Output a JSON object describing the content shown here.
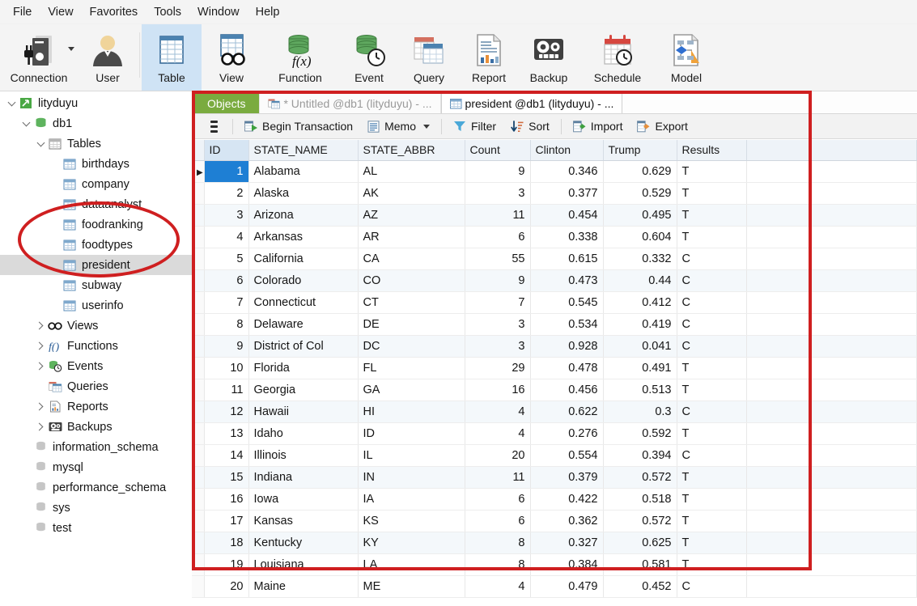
{
  "menubar": {
    "items": [
      "File",
      "View",
      "Favorites",
      "Tools",
      "Window",
      "Help"
    ]
  },
  "ribbon": {
    "buttons": [
      {
        "label": "Connection",
        "icon": "connection-icon",
        "has_dropdown": true,
        "selected": false
      },
      {
        "label": "User",
        "icon": "user-icon",
        "has_dropdown": false,
        "selected": false
      },
      {
        "label": "Table",
        "icon": "table-icon",
        "has_dropdown": false,
        "selected": true
      },
      {
        "label": "View",
        "icon": "view-icon",
        "has_dropdown": false,
        "selected": false
      },
      {
        "label": "Function",
        "icon": "function-icon",
        "has_dropdown": false,
        "selected": false
      },
      {
        "label": "Event",
        "icon": "event-icon",
        "has_dropdown": false,
        "selected": false
      },
      {
        "label": "Query",
        "icon": "query-icon",
        "has_dropdown": false,
        "selected": false
      },
      {
        "label": "Report",
        "icon": "report-icon",
        "has_dropdown": false,
        "selected": false
      },
      {
        "label": "Backup",
        "icon": "backup-icon",
        "has_dropdown": false,
        "selected": false
      },
      {
        "label": "Schedule",
        "icon": "schedule-icon",
        "has_dropdown": false,
        "selected": false
      },
      {
        "label": "Model",
        "icon": "model-icon",
        "has_dropdown": false,
        "selected": false
      }
    ]
  },
  "sidebar": {
    "nodes": [
      {
        "label": "lityduyu",
        "indent": 0,
        "twisty": "open",
        "icon": "connection-node-icon",
        "highlight": false
      },
      {
        "label": "db1",
        "indent": 1,
        "twisty": "open",
        "icon": "database-green-icon",
        "highlight": false
      },
      {
        "label": "Tables",
        "indent": 2,
        "twisty": "open",
        "icon": "tables-folder-icon",
        "highlight": false
      },
      {
        "label": "birthdays",
        "indent": 3,
        "twisty": "none",
        "icon": "table-icon",
        "highlight": false
      },
      {
        "label": "company",
        "indent": 3,
        "twisty": "none",
        "icon": "table-icon",
        "highlight": false
      },
      {
        "label": "dataanalyst",
        "indent": 3,
        "twisty": "none",
        "icon": "table-icon",
        "highlight": false
      },
      {
        "label": "foodranking",
        "indent": 3,
        "twisty": "none",
        "icon": "table-icon",
        "highlight": false
      },
      {
        "label": "foodtypes",
        "indent": 3,
        "twisty": "none",
        "icon": "table-icon",
        "highlight": false
      },
      {
        "label": "president",
        "indent": 3,
        "twisty": "none",
        "icon": "table-icon",
        "highlight": true
      },
      {
        "label": "subway",
        "indent": 3,
        "twisty": "none",
        "icon": "table-icon",
        "highlight": false
      },
      {
        "label": "userinfo",
        "indent": 3,
        "twisty": "none",
        "icon": "table-icon",
        "highlight": false
      },
      {
        "label": "Views",
        "indent": 2,
        "twisty": "closed",
        "icon": "views-icon",
        "highlight": false
      },
      {
        "label": "Functions",
        "indent": 2,
        "twisty": "closed",
        "icon": "functions-icon",
        "highlight": false
      },
      {
        "label": "Events",
        "indent": 2,
        "twisty": "closed",
        "icon": "events-icon",
        "highlight": false
      },
      {
        "label": "Queries",
        "indent": 2,
        "twisty": "none",
        "icon": "queries-icon",
        "highlight": false
      },
      {
        "label": "Reports",
        "indent": 2,
        "twisty": "closed",
        "icon": "reports-icon",
        "highlight": false
      },
      {
        "label": "Backups",
        "indent": 2,
        "twisty": "closed",
        "icon": "backups-icon",
        "highlight": false
      },
      {
        "label": "information_schema",
        "indent": 1,
        "twisty": "none",
        "icon": "database-grey-icon",
        "highlight": false
      },
      {
        "label": "mysql",
        "indent": 1,
        "twisty": "none",
        "icon": "database-grey-icon",
        "highlight": false
      },
      {
        "label": "performance_schema",
        "indent": 1,
        "twisty": "none",
        "icon": "database-grey-icon",
        "highlight": false
      },
      {
        "label": "sys",
        "indent": 1,
        "twisty": "none",
        "icon": "database-grey-icon",
        "highlight": false
      },
      {
        "label": "test",
        "indent": 1,
        "twisty": "none",
        "icon": "database-grey-icon",
        "highlight": false
      }
    ]
  },
  "tabs": [
    {
      "label": "Objects",
      "type": "objects",
      "icon": null
    },
    {
      "label": "* Untitled @db1 (lityduyu) - ...",
      "type": "inactive",
      "icon": "query-tab-icon"
    },
    {
      "label": "president @db1 (lityduyu) - ...",
      "type": "active",
      "icon": "table-tab-icon"
    }
  ],
  "grid_toolbar": {
    "menu_icon": "hamburger-icon",
    "items": [
      {
        "label": "Begin Transaction",
        "icon": "transaction-icon",
        "dropdown": false
      },
      {
        "label": "Memo",
        "icon": "memo-icon",
        "dropdown": true
      },
      {
        "label": "Filter",
        "icon": "filter-icon",
        "dropdown": false
      },
      {
        "label": "Sort",
        "icon": "sort-icon",
        "dropdown": false
      },
      {
        "label": "Import",
        "icon": "import-icon",
        "dropdown": false
      },
      {
        "label": "Export",
        "icon": "export-icon",
        "dropdown": false
      }
    ]
  },
  "table": {
    "columns": [
      "ID",
      "STATE_NAME",
      "STATE_ABBR",
      "Count",
      "Clinton",
      "Trump",
      "Results"
    ],
    "selected_row_index": 0,
    "rows": [
      {
        "ID": "1",
        "STATE_NAME": "Alabama",
        "STATE_ABBR": "AL",
        "Count": "9",
        "Clinton": "0.346",
        "Trump": "0.629",
        "Results": "T"
      },
      {
        "ID": "2",
        "STATE_NAME": "Alaska",
        "STATE_ABBR": "AK",
        "Count": "3",
        "Clinton": "0.377",
        "Trump": "0.529",
        "Results": "T"
      },
      {
        "ID": "3",
        "STATE_NAME": "Arizona",
        "STATE_ABBR": "AZ",
        "Count": "11",
        "Clinton": "0.454",
        "Trump": "0.495",
        "Results": "T"
      },
      {
        "ID": "4",
        "STATE_NAME": "Arkansas",
        "STATE_ABBR": "AR",
        "Count": "6",
        "Clinton": "0.338",
        "Trump": "0.604",
        "Results": "T"
      },
      {
        "ID": "5",
        "STATE_NAME": "California",
        "STATE_ABBR": "CA",
        "Count": "55",
        "Clinton": "0.615",
        "Trump": "0.332",
        "Results": "C"
      },
      {
        "ID": "6",
        "STATE_NAME": "Colorado",
        "STATE_ABBR": "CO",
        "Count": "9",
        "Clinton": "0.473",
        "Trump": "0.44",
        "Results": "C"
      },
      {
        "ID": "7",
        "STATE_NAME": "Connecticut",
        "STATE_ABBR": "CT",
        "Count": "7",
        "Clinton": "0.545",
        "Trump": "0.412",
        "Results": "C"
      },
      {
        "ID": "8",
        "STATE_NAME": "Delaware",
        "STATE_ABBR": "DE",
        "Count": "3",
        "Clinton": "0.534",
        "Trump": "0.419",
        "Results": "C"
      },
      {
        "ID": "9",
        "STATE_NAME": "District of Col",
        "STATE_ABBR": "DC",
        "Count": "3",
        "Clinton": "0.928",
        "Trump": "0.041",
        "Results": "C"
      },
      {
        "ID": "10",
        "STATE_NAME": "Florida",
        "STATE_ABBR": "FL",
        "Count": "29",
        "Clinton": "0.478",
        "Trump": "0.491",
        "Results": "T"
      },
      {
        "ID": "11",
        "STATE_NAME": "Georgia",
        "STATE_ABBR": "GA",
        "Count": "16",
        "Clinton": "0.456",
        "Trump": "0.513",
        "Results": "T"
      },
      {
        "ID": "12",
        "STATE_NAME": "Hawaii",
        "STATE_ABBR": "HI",
        "Count": "4",
        "Clinton": "0.622",
        "Trump": "0.3",
        "Results": "C"
      },
      {
        "ID": "13",
        "STATE_NAME": "Idaho",
        "STATE_ABBR": "ID",
        "Count": "4",
        "Clinton": "0.276",
        "Trump": "0.592",
        "Results": "T"
      },
      {
        "ID": "14",
        "STATE_NAME": "Illinois",
        "STATE_ABBR": "IL",
        "Count": "20",
        "Clinton": "0.554",
        "Trump": "0.394",
        "Results": "C"
      },
      {
        "ID": "15",
        "STATE_NAME": "Indiana",
        "STATE_ABBR": "IN",
        "Count": "11",
        "Clinton": "0.379",
        "Trump": "0.572",
        "Results": "T"
      },
      {
        "ID": "16",
        "STATE_NAME": "Iowa",
        "STATE_ABBR": "IA",
        "Count": "6",
        "Clinton": "0.422",
        "Trump": "0.518",
        "Results": "T"
      },
      {
        "ID": "17",
        "STATE_NAME": "Kansas",
        "STATE_ABBR": "KS",
        "Count": "6",
        "Clinton": "0.362",
        "Trump": "0.572",
        "Results": "T"
      },
      {
        "ID": "18",
        "STATE_NAME": "Kentucky",
        "STATE_ABBR": "KY",
        "Count": "8",
        "Clinton": "0.327",
        "Trump": "0.625",
        "Results": "T"
      },
      {
        "ID": "19",
        "STATE_NAME": "Louisiana",
        "STATE_ABBR": "LA",
        "Count": "8",
        "Clinton": "0.384",
        "Trump": "0.581",
        "Results": "T"
      },
      {
        "ID": "20",
        "STATE_NAME": "Maine",
        "STATE_ABBR": "ME",
        "Count": "4",
        "Clinton": "0.479",
        "Trump": "0.452",
        "Results": "C"
      }
    ]
  },
  "annotations": {
    "rectangle_color": "#cf1f20",
    "ellipse_color": "#cf1f20"
  }
}
